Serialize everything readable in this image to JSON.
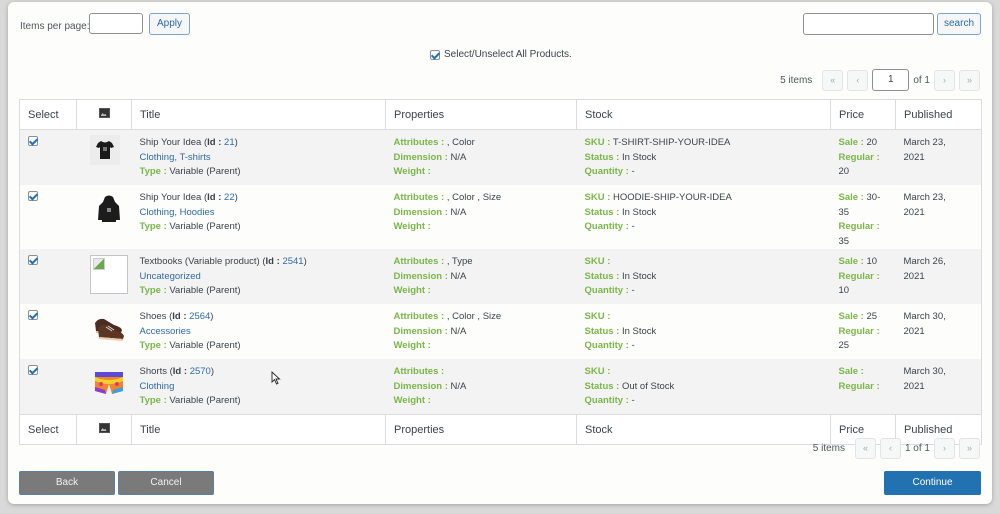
{
  "toolbar": {
    "items_per_page_label": "Items per page:",
    "items_per_page_value": "",
    "apply_label": "Apply",
    "search_value": "",
    "search_label": "search",
    "select_all_label": "Select/Unselect All Products.",
    "select_all_checked": true
  },
  "pagination": {
    "count": "5 items",
    "first": "«",
    "prev": "‹",
    "current_page": "1",
    "of_total": "of 1",
    "bottom_current": "1 of 1",
    "next": "›",
    "last": "»"
  },
  "table": {
    "columns": [
      "Select",
      "image-icon",
      "Title",
      "Properties",
      "Stock",
      "Price",
      "Published"
    ],
    "labels": {
      "id": "Id",
      "type": "Type :",
      "attributes": "Attributes :",
      "dimension": "Dimension :",
      "weight": "Weight :",
      "sku": "SKU :",
      "status": "Status :",
      "quantity": "Quantity :",
      "sale": "Sale :",
      "regular": "Regular :"
    },
    "rows": [
      {
        "checked": true,
        "image": "t-shirt-thumbnail",
        "name": "Ship Your Idea",
        "id": "21",
        "categories": "Clothing, T-shirts",
        "type": "Variable (Parent)",
        "attributes": ", Color",
        "dimension": "N/A",
        "weight": "",
        "sku": "T-SHIRT-SHIP-YOUR-IDEA",
        "status": "In Stock",
        "quantity": "-",
        "sale": "20",
        "regular": "20",
        "published_date": "March 23,",
        "published_year": "2021"
      },
      {
        "checked": true,
        "image": "hoodie-thumbnail",
        "name": "Ship Your Idea",
        "id": "22",
        "categories": "Clothing, Hoodies",
        "type": "Variable (Parent)",
        "attributes": ", Color , Size",
        "dimension": "N/A",
        "weight": "",
        "sku": "HOODIE-SHIP-YOUR-IDEA",
        "status": "In Stock",
        "quantity": "-",
        "sale": "30-35",
        "regular": "35",
        "published_date": "March 23,",
        "published_year": "2021"
      },
      {
        "checked": true,
        "image": "broken-image",
        "name": "Textbooks (Variable product)",
        "id": "2541",
        "categories": "Uncategorized",
        "type": "Variable (Parent)",
        "attributes": ", Type",
        "dimension": "N/A",
        "weight": "",
        "sku": "",
        "status": "In Stock",
        "quantity": "-",
        "sale": "10",
        "regular": "10",
        "published_date": "March 26,",
        "published_year": "2021"
      },
      {
        "checked": true,
        "image": "shoes-thumbnail",
        "name": "Shoes",
        "id": "2564",
        "categories": "Accessories",
        "type": "Variable (Parent)",
        "attributes": ", Color , Size",
        "dimension": "N/A",
        "weight": "",
        "sku": "",
        "status": "In Stock",
        "quantity": "-",
        "sale": "25",
        "regular": "25",
        "published_date": "March 30,",
        "published_year": "2021"
      },
      {
        "checked": true,
        "image": "shorts-thumbnail",
        "name": "Shorts",
        "id": "2570",
        "categories": "Clothing",
        "type": "Variable (Parent)",
        "attributes": "",
        "dimension": "N/A",
        "weight": "",
        "sku": "",
        "status": "Out of Stock",
        "quantity": "-",
        "sale": "",
        "regular": "",
        "published_date": "March 30,",
        "published_year": "2021"
      }
    ]
  },
  "footer": {
    "back_label": "Back",
    "cancel_label": "Cancel",
    "continue_label": "Continue"
  },
  "colors": {
    "accent": "#2271b1",
    "label_green": "#7ab648",
    "link_blue": "#2f6aa6",
    "gray_button": "#7a7a7a"
  }
}
